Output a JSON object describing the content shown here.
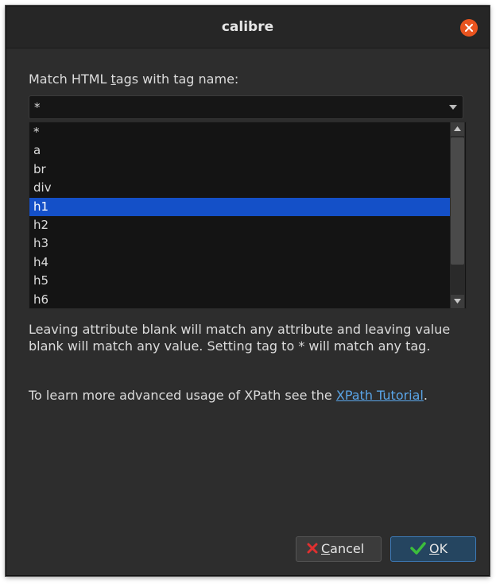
{
  "window": {
    "title": "calibre"
  },
  "prompt": {
    "pre": "Match HTML ",
    "mnemonic": "t",
    "post": "ags with tag name:"
  },
  "combo": {
    "value": "*"
  },
  "list": {
    "items": [
      "*",
      "a",
      "br",
      "div",
      "h1",
      "h2",
      "h3",
      "h4",
      "h5",
      "h6"
    ],
    "selected_index": 4
  },
  "help": {
    "text": "Leaving attribute blank will match any attribute and leaving value blank will match any value. Setting tag to * will match any tag."
  },
  "tutorial": {
    "pre": "To learn more advanced usage of XPath see the ",
    "link": "XPath Tutorial",
    "post": "."
  },
  "buttons": {
    "cancel": {
      "mnemonic": "C",
      "rest": "ancel"
    },
    "ok": {
      "mnemonic": "O",
      "rest": "K"
    }
  },
  "icons": {
    "close": "close-icon",
    "cancel": "x-icon",
    "ok": "checkmark-icon",
    "combo": "chevron-down-icon"
  },
  "colors": {
    "selection": "#1450c8",
    "link": "#5aa5e8",
    "close": "#e9541f",
    "ok_icon": "#3cbe3c",
    "cancel_icon": "#e03030"
  }
}
